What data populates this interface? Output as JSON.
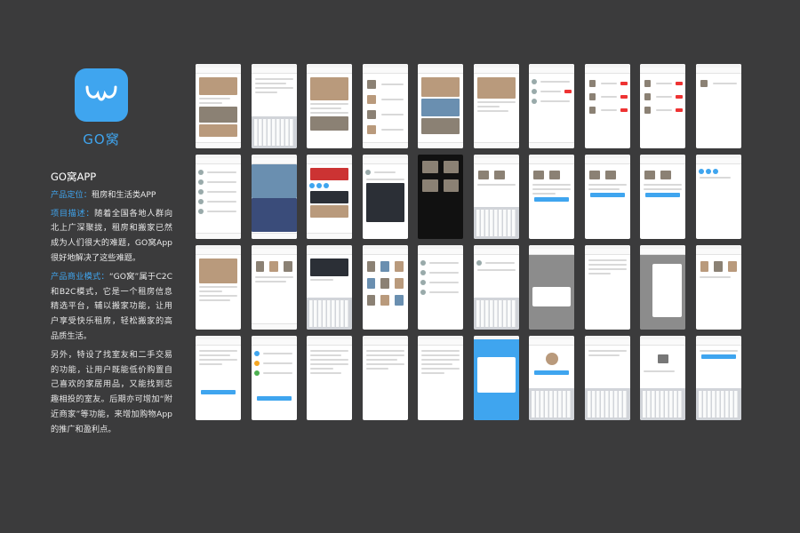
{
  "app": {
    "name": "GO窝",
    "brand_color": "#3fa5ef",
    "icon": "paw-smile-icon"
  },
  "info": {
    "title": "GO窝APP",
    "positioning_label": "产品定位：",
    "positioning_text": "租房和生活类APP",
    "description_label": "项目描述：",
    "description_text": "随着全国各地人群向北上广深聚拢，租房和搬家已然成为人们很大的难题，GO窝App很好地解决了这些难题。",
    "business_label": "产品商业模式：",
    "business_text": "“GO窝”属于C2C和B2C模式，它是一个租房信息精选平台，辅以搬家功能，让用户享受快乐租房，轻松搬家的高品质生活。",
    "extra_text": "另外，特设了找室友和二手交易的功能，让用户既能低价购置自己喜欢的家居用品，又能找到志趣相投的室友。后期亦可增加“附近商家”等功能，来增加购物App的推广和盈利点。"
  }
}
